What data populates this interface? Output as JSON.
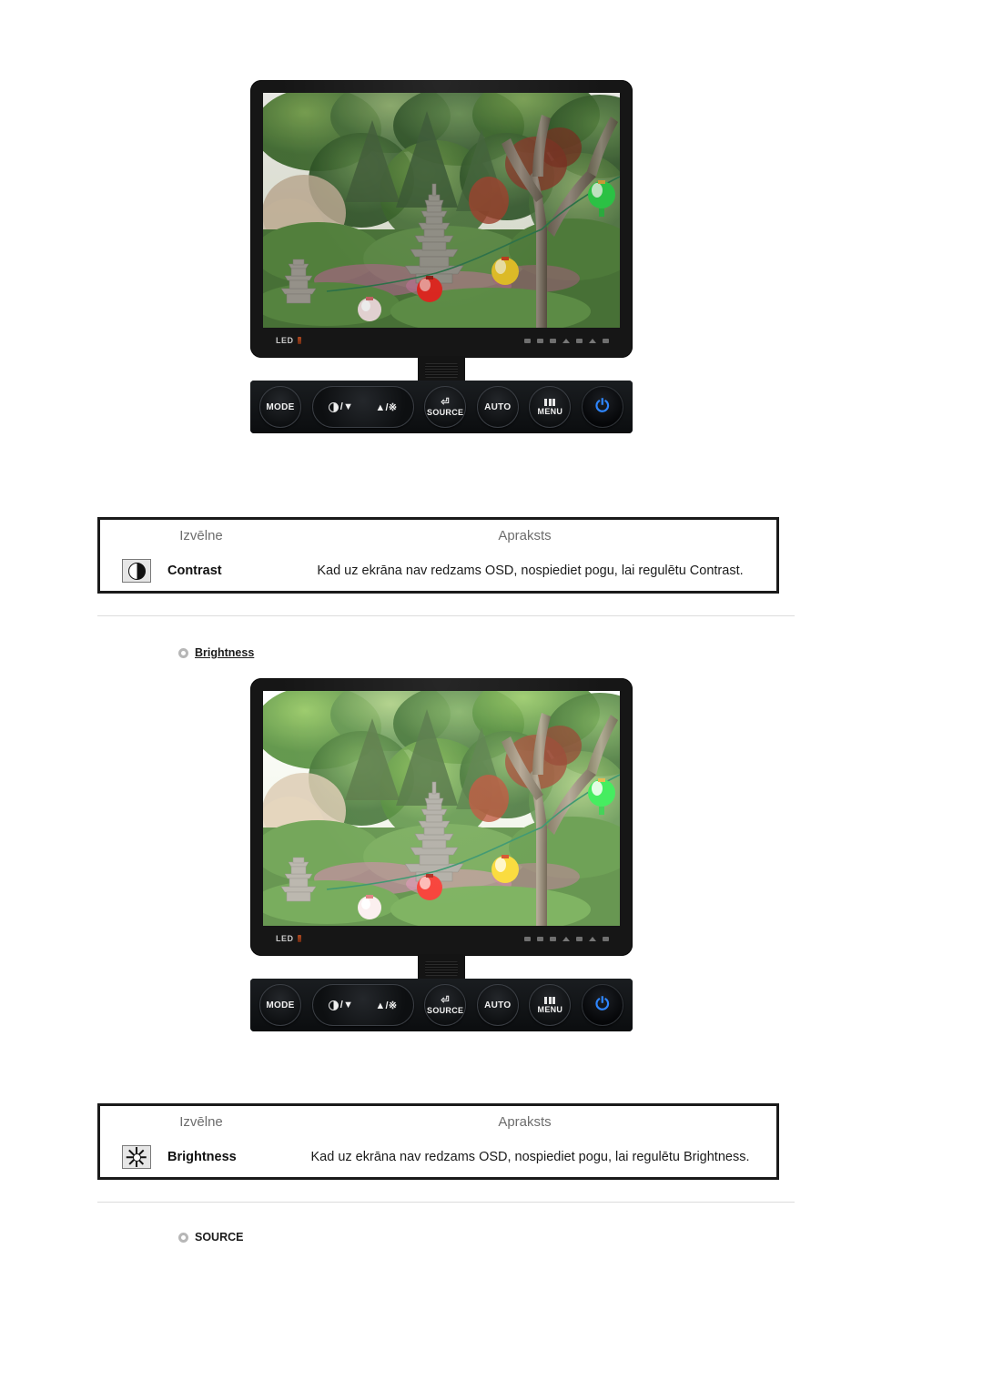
{
  "document": {
    "language": "lv",
    "page_background": "#ffffff"
  },
  "monitor": {
    "led_label": "LED",
    "buttons": [
      {
        "name": "mode",
        "label": "MODE"
      },
      {
        "name": "contrast-down-brightness-up",
        "label_left": "/▼",
        "label_right": "▲/※"
      },
      {
        "name": "source",
        "label": "SOURCE",
        "glyph": "enter-icon"
      },
      {
        "name": "auto",
        "label": "AUTO"
      },
      {
        "name": "menu",
        "label": "MENU",
        "glyph": "menu-bars-icon"
      },
      {
        "name": "power",
        "label": "⏻"
      }
    ],
    "bezel_indicator_count": 7
  },
  "sections": [
    {
      "id": "brightness-heading",
      "label": "Brightness",
      "bullet": "circle-bullet-icon",
      "underline": true
    },
    {
      "id": "source-heading",
      "label": "SOURCE",
      "bullet": "circle-bullet-icon",
      "underline": false
    }
  ],
  "tables": [
    {
      "id": "contrast-table",
      "headers": {
        "menu": "Izvēlne",
        "description": "Apraksts"
      },
      "row": {
        "icon": "contrast-icon",
        "name": "Contrast",
        "description": "Kad uz ekrāna nav redzams OSD, nospiediet pogu, lai regulētu Contrast."
      }
    },
    {
      "id": "brightness-table",
      "headers": {
        "menu": "Izvēlne",
        "description": "Apraksts"
      },
      "row": {
        "icon": "brightness-icon",
        "name": "Brightness",
        "description": "Kad uz ekrāna nav redzams OSD, nospiediet pogu, lai regulētu Brightness."
      }
    }
  ],
  "colors": {
    "header_text": "#6d6d6d",
    "body_text": "#1b1b1b",
    "table_border": "#1a1a1a",
    "divider": "#dcdcdc",
    "power_accent": "#2e86ff"
  }
}
